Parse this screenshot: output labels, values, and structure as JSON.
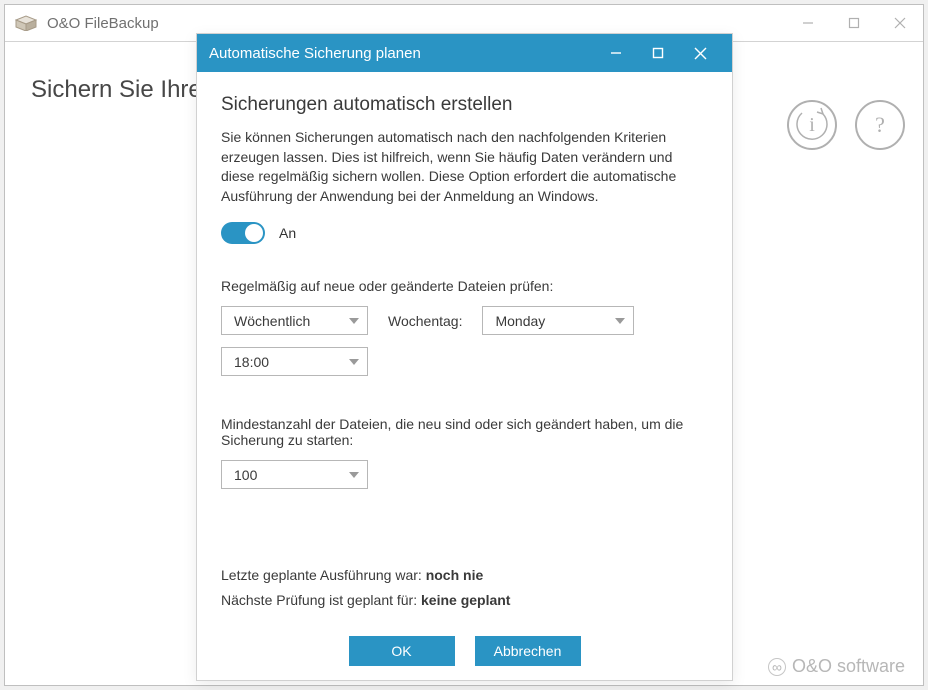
{
  "main_window": {
    "title": "O&O FileBackup",
    "hero": "Sichern Sie Ihre Daten"
  },
  "brand": {
    "prefix": "O&O",
    "suffix": "software"
  },
  "modal": {
    "title": "Automatische Sicherung planen",
    "heading": "Sicherungen automatisch erstellen",
    "description": "Sie können Sicherungen automatisch nach den nachfolgenden Kriterien erzeugen lassen. Dies ist hilfreich, wenn Sie häufig Daten verändern und diese regelmäßig sichern wollen. Diese Option erfordert die automatische Ausführung der Anwendung bei der Anmeldung an Windows.",
    "toggle": {
      "state_label": "An",
      "on": true
    },
    "check_label": "Regelmäßig auf neue oder geänderte Dateien prüfen:",
    "frequency": {
      "value": "Wöchentlich"
    },
    "weekday_label": "Wochentag:",
    "weekday": {
      "value": "Monday"
    },
    "time": {
      "value": "18:00"
    },
    "min_label": "Mindestanzahl der Dateien, die neu sind oder sich geändert haben, um die Sicherung zu starten:",
    "min_count": {
      "value": "100"
    },
    "last_run_label": "Letzte geplante Ausführung war: ",
    "last_run_value": "noch nie",
    "next_run_label": "Nächste Prüfung ist geplant für: ",
    "next_run_value": "keine geplant",
    "ok_label": "OK",
    "cancel_label": "Abbrechen"
  }
}
